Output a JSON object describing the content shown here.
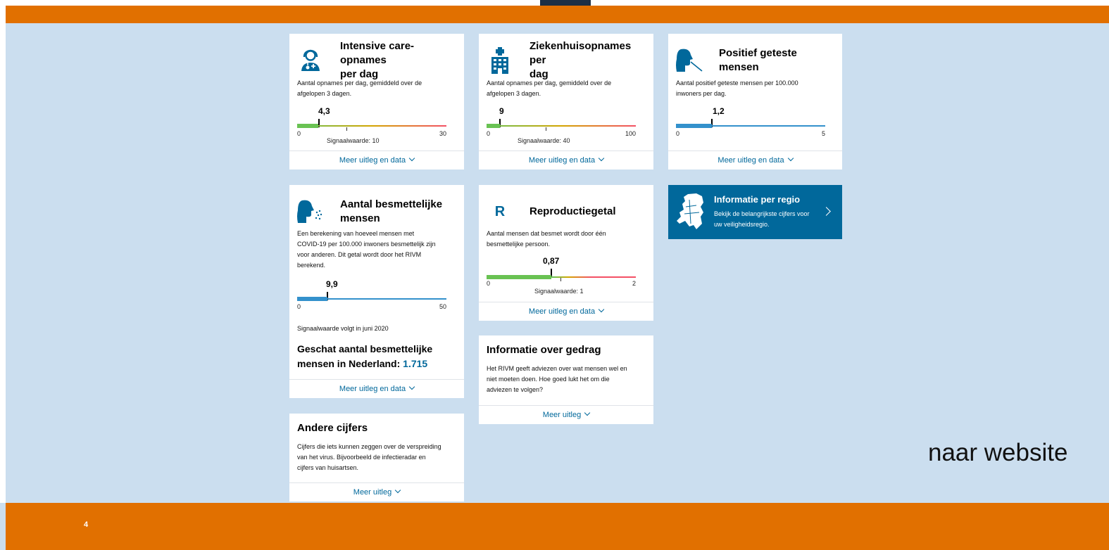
{
  "slide": {
    "page_number": "4",
    "link_text": "naar website"
  },
  "cards": {
    "ic": {
      "title_line1": "Intensive care-opnames",
      "title_line2": "per dag",
      "desc_line1": "Aantal opnames per dag, gemiddeld over de",
      "desc_line2": "afgelopen 3 dagen.",
      "value": "4,3",
      "value_num": 4.3,
      "min": "0",
      "max": "30",
      "max_num": 30,
      "signal": "Signaalwaarde: 10",
      "footer": "Meer uitleg en data"
    },
    "hospital": {
      "title_line1": "Ziekenhuisopnames per",
      "title_line2": "dag",
      "desc_line1": "Aantal opnames per dag, gemiddeld over de",
      "desc_line2": "afgelopen 3 dagen.",
      "value": "9",
      "value_num": 9,
      "min": "0",
      "max": "100",
      "max_num": 100,
      "signal": "Signaalwaarde: 40",
      "footer": "Meer uitleg en data"
    },
    "positive": {
      "title": "Positief geteste mensen",
      "desc_line1": "Aantal positief geteste mensen per 100.000",
      "desc_line2": "inwoners per dag.",
      "value": "1,2",
      "value_num": 1.2,
      "min": "0",
      "max": "5",
      "max_num": 5,
      "footer": "Meer uitleg en data"
    },
    "infectious": {
      "title_line1": "Aantal besmettelijke",
      "title_line2": "mensen",
      "desc_line1": "Een berekening van hoeveel mensen met",
      "desc_line2": "COVID-19 per 100.000 inwoners besmettelijk zijn",
      "desc_line3": "voor anderen. Dit getal wordt door het RIVM",
      "desc_line4": "berekend.",
      "value": "9,9",
      "value_num": 9.9,
      "min": "0",
      "max": "50",
      "max_num": 50,
      "signal_note": "Signaalwaarde volgt in juni 2020",
      "estimate_line1": "Geschat aantal besmettelijke",
      "estimate_line2": "mensen in Nederland: ",
      "estimate_value": "1.715",
      "footer": "Meer uitleg en data"
    },
    "reproduction": {
      "icon_letter": "R",
      "title": "Reproductiegetal",
      "desc_line1": "Aantal mensen dat besmet wordt door één",
      "desc_line2": "besmettelijke persoon.",
      "value": "0,87",
      "value_num": 0.87,
      "min": "0",
      "max": "2",
      "max_num": 2,
      "signal": "Signaalwaarde: 1",
      "footer": "Meer uitleg en data"
    },
    "behaviour": {
      "title": "Informatie over gedrag",
      "desc_line1": "Het RIVM geeft adviezen over wat mensen wel en",
      "desc_line2": "niet moeten doen. Hoe goed lukt het om die",
      "desc_line3": "adviezen te volgen?",
      "footer": "Meer uitleg"
    },
    "other": {
      "title": "Andere cijfers",
      "desc_line1": "Cijfers die iets kunnen zeggen over de verspreiding",
      "desc_line2": "van het virus. Bijvoorbeeld de infectieradar en",
      "desc_line3": "cijfers van huisartsen.",
      "footer": "Meer uitleg"
    },
    "region": {
      "title": "Informatie per regio",
      "desc_line1": "Bekijk de belangrijkste cijfers voor",
      "desc_line2": "uw veiligheidsregio."
    }
  },
  "colors": {
    "orange": "#e17000",
    "background": "#cbdeef",
    "accent_blue": "#01689b",
    "bar_blue": "#3391cc",
    "green": "#69c253",
    "red": "#f35065"
  },
  "icons": [
    "doctor-icon",
    "hospital-icon",
    "test-person-icon",
    "coughing-person-icon",
    "reproduction-r-icon",
    "netherlands-map-icon",
    "chevron-down-icon",
    "chevron-right-icon"
  ]
}
